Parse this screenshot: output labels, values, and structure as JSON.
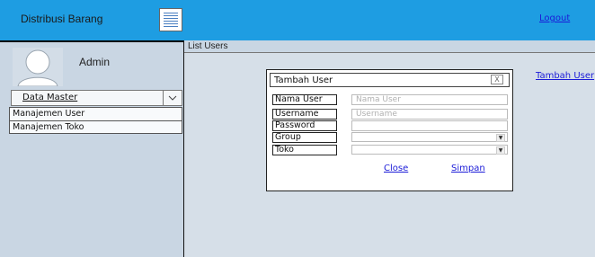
{
  "header": {
    "app_title": "Distribusi Barang",
    "menu_icon": "hamburger-menu-icon",
    "logout_label": "Logout",
    "color": "#1e9de2"
  },
  "sidebar": {
    "user_name": "Admin",
    "avatar_icon": "user-avatar-icon",
    "dropdown": {
      "label": "Data Master",
      "icon": "chevron-down-icon"
    },
    "items": [
      {
        "label": "Manajemen User"
      },
      {
        "label": "Manajemen Toko"
      }
    ]
  },
  "main": {
    "panel_title": "List Users",
    "add_user_label": "Tambah User"
  },
  "modal": {
    "title": "Tambah User",
    "close_icon": "close-icon",
    "fields": [
      {
        "label": "Nama User",
        "placeholder": "Nama User"
      },
      {
        "label": "Username",
        "placeholder": "Username"
      },
      {
        "label": "Password",
        "placeholder": ""
      },
      {
        "label": "Group",
        "placeholder": ""
      },
      {
        "label": "Toko",
        "placeholder": ""
      }
    ],
    "close_label": "Close",
    "save_label": "Simpan"
  }
}
